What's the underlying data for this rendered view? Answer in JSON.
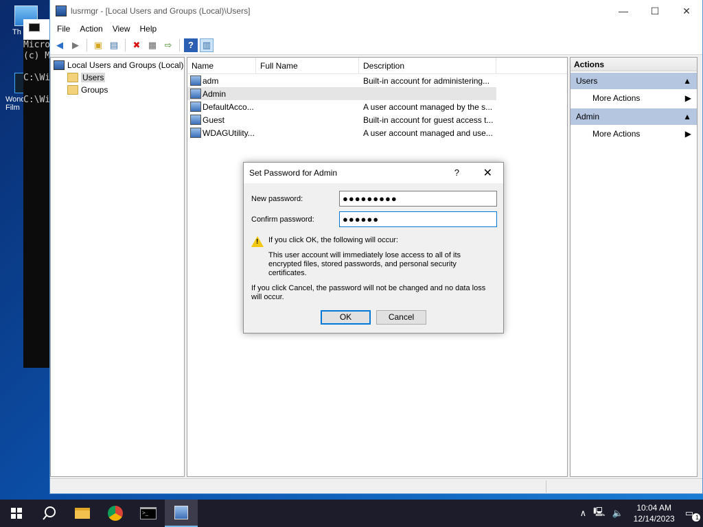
{
  "desktop": {
    "icons": [
      {
        "label": "Th",
        "name": "this-pc"
      },
      {
        "label": "Wond Film",
        "name": "wondershare-filmora"
      }
    ]
  },
  "cmd": {
    "lines": [
      "Micro",
      "(c) M",
      "",
      "C:\\Wi",
      "",
      "C:\\Wi"
    ]
  },
  "window": {
    "title": "lusrmgr - [Local Users and Groups (Local)\\Users]",
    "controls": {
      "minimize": "—",
      "maximize": "☐",
      "close": "✕"
    },
    "menu": [
      "File",
      "Action",
      "View",
      "Help"
    ]
  },
  "tree": {
    "root": "Local Users and Groups (Local)",
    "children": [
      {
        "label": "Users",
        "selected": true
      },
      {
        "label": "Groups",
        "selected": false
      }
    ]
  },
  "list": {
    "columns": [
      "Name",
      "Full Name",
      "Description"
    ],
    "rows": [
      {
        "name": "adm",
        "full_name": "",
        "description": "Built-in account for administering..."
      },
      {
        "name": "Admin",
        "full_name": "",
        "description": ""
      },
      {
        "name": "DefaultAcco...",
        "full_name": "",
        "description": "A user account managed by the s..."
      },
      {
        "name": "Guest",
        "full_name": "",
        "description": "Built-in account for guest access t..."
      },
      {
        "name": "WDAGUtility...",
        "full_name": "",
        "description": "A user account managed and use..."
      }
    ]
  },
  "actions": {
    "header": "Actions",
    "groups": [
      {
        "title": "Users",
        "items": [
          "More Actions"
        ]
      },
      {
        "title": "Admin",
        "items": [
          "More Actions"
        ]
      }
    ]
  },
  "dialog": {
    "title": "Set Password for Admin",
    "help": "?",
    "close": "✕",
    "new_password_label": "New password:",
    "new_password_value": "●●●●●●●●●",
    "confirm_password_label": "Confirm password:",
    "confirm_password_value": "●●●●●●",
    "warning_heading": "If you click OK, the following will occur:",
    "warning_body": "This user account will immediately lose access to all of its encrypted files, stored passwords, and personal security certificates.",
    "cancel_note": "If you click Cancel, the password will not be changed and no data loss will occur.",
    "ok_label": "OK",
    "cancel_label": "Cancel"
  },
  "taskbar": {
    "time": "10:04 AM",
    "date": "12/14/2023",
    "notification_count": "1"
  }
}
